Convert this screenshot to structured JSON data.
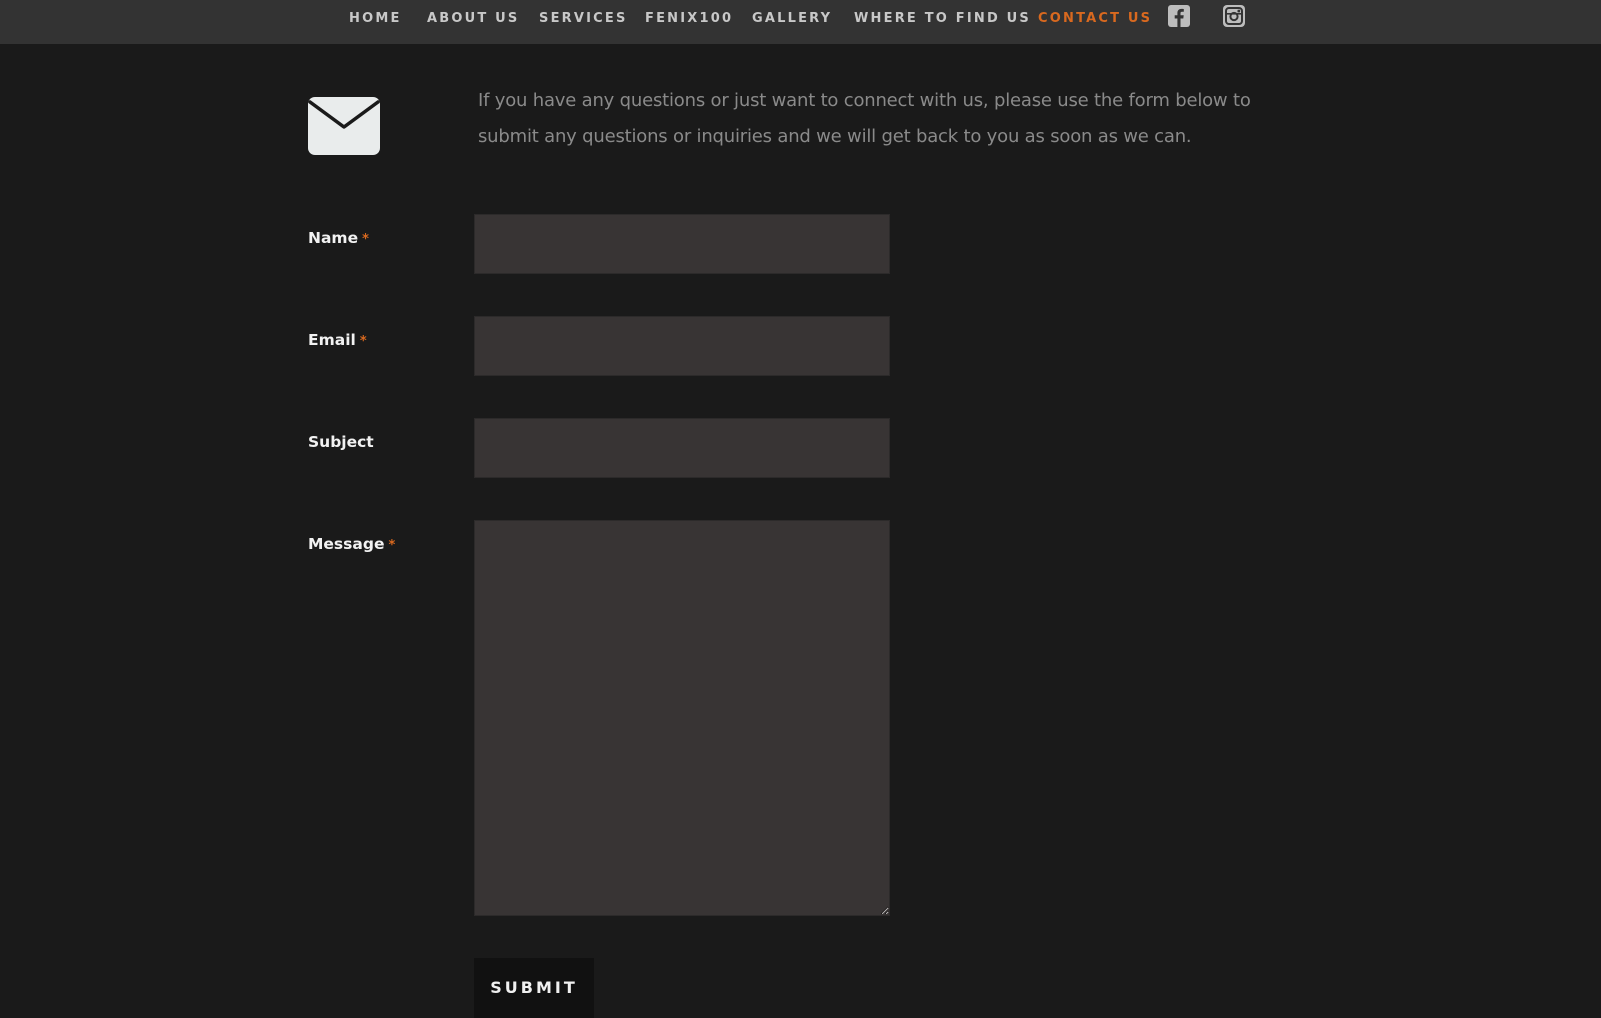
{
  "nav": {
    "items": [
      {
        "label": "HOME"
      },
      {
        "label": "ABOUT US"
      },
      {
        "label": "SERVICES"
      },
      {
        "label": "FENIX100"
      },
      {
        "label": "GALLERY"
      },
      {
        "label": "WHERE TO FIND US"
      },
      {
        "label": "CONTACT US",
        "active": true
      }
    ],
    "social": [
      "facebook-icon",
      "instagram-icon"
    ],
    "active_color": "#d9691f"
  },
  "intro": {
    "icon": "envelope-icon",
    "text": "If you have any questions or just want to connect with us, please use the form below to submit any questions or inquiries and we will get back to you as soon as we can."
  },
  "form": {
    "name": {
      "label": "Name",
      "required_mark": "*",
      "value": ""
    },
    "email": {
      "label": "Email",
      "required_mark": "*",
      "value": ""
    },
    "subject": {
      "label": "Subject",
      "value": ""
    },
    "message": {
      "label": "Message",
      "required_mark": "*",
      "value": ""
    },
    "submit_label": "SUBMIT"
  },
  "colors": {
    "background": "#1a1a1a",
    "nav_background": "#333333",
    "field_background": "#383434",
    "accent": "#d9691f"
  }
}
